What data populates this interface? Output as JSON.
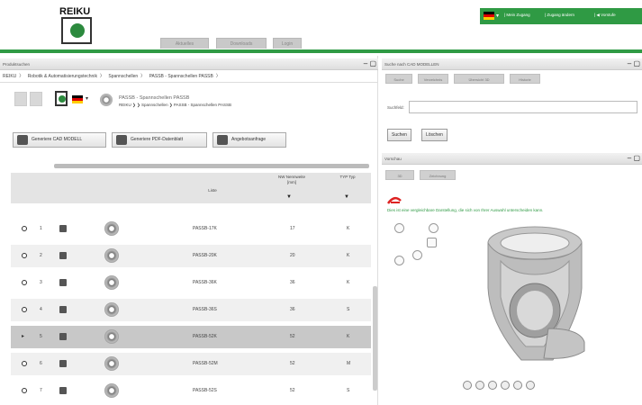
{
  "brand": {
    "logo_text": "REIKU",
    "accent": "#2f9a44",
    "logo_green": "#2c8a3e"
  },
  "header": {
    "tabs": [
      "Aktuelles",
      "Downloads",
      "Login"
    ],
    "topbar": {
      "lang": "de",
      "links": [
        "| Mein Zugang",
        "| Zugang ändern",
        "| ◀ Vorstufe"
      ]
    }
  },
  "left_panel": {
    "title": "Produktsuchen",
    "breadcrumb": [
      "REIKU",
      "Robotik & Automatisierungstechnik",
      "Spannschellen",
      "PASSB - Spannschellen PASSB"
    ],
    "product": {
      "title": "PASSB - Spannschellen PASSB",
      "path": "REIKU ❯ ❯ Spannschellen ❯ PASSB - Spannschellen PASSB"
    },
    "actions": [
      "Generiere CAD MODELL",
      "Generiere PDF-Datenblatt",
      "Angebotsanfrage"
    ],
    "table": {
      "headers": {
        "type": "Liste",
        "nenn": "NW Nennweite [mm]",
        "typ": "TYP Typ"
      },
      "rows": [
        {
          "n": "1",
          "type": "PASSB-17K",
          "nenn": "17",
          "typ": "K",
          "selected": false
        },
        {
          "n": "2",
          "type": "PASSB-20K",
          "nenn": "20",
          "typ": "K",
          "selected": false
        },
        {
          "n": "3",
          "type": "PASSB-36K",
          "nenn": "36",
          "typ": "K",
          "selected": false
        },
        {
          "n": "4",
          "type": "PASSB-36S",
          "nenn": "36",
          "typ": "S",
          "selected": false
        },
        {
          "n": "5",
          "type": "PASSB-52K",
          "nenn": "52",
          "typ": "K",
          "selected": true
        },
        {
          "n": "6",
          "type": "PASSB-52M",
          "nenn": "52",
          "typ": "M",
          "selected": false
        },
        {
          "n": "7",
          "type": "PASSB-52S",
          "nenn": "52",
          "typ": "S",
          "selected": false
        }
      ]
    }
  },
  "right_panel": {
    "title": "Suche nach CAD MODELLEN",
    "tabs": [
      "Suche",
      "Verzeichnis",
      "Übersicht 3D",
      "Historie"
    ],
    "search_label": "Suchfeld:",
    "search_value": "",
    "buttons": [
      "Suchen",
      "Löschen"
    ],
    "preview_title": "Vorschau",
    "preview_tabs": [
      "3D",
      "Zeichnung"
    ],
    "hint": "Dies ist eine vergleichbare Darstellung, die sich von Ihrer Auswahl unterscheiden kann."
  }
}
